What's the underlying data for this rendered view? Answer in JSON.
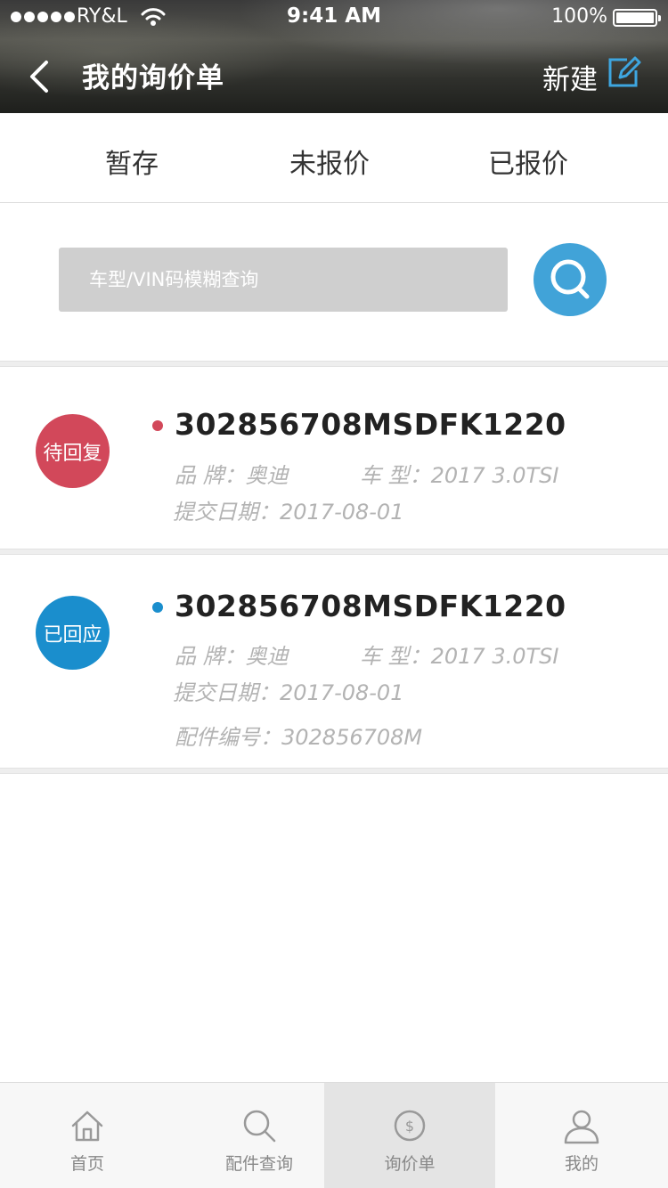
{
  "status_bar": {
    "carrier": "RY&L",
    "time": "9:41 AM",
    "battery": "100%"
  },
  "header": {
    "title": "我的询价单",
    "new_label": "新建"
  },
  "tabs": [
    {
      "label": "暂存"
    },
    {
      "label": "未报价"
    },
    {
      "label": "已报价"
    }
  ],
  "search": {
    "placeholder": "车型/VIN码模糊查询"
  },
  "cards": [
    {
      "status": "待回复",
      "status_color": "#d2485a",
      "dot_color": "#d2485a",
      "id": "302856708MSDFK1220",
      "brand": "品  牌：奥迪",
      "model": "车    型：2017 3.0TSI",
      "date": "提交日期：2017-08-01"
    },
    {
      "status": "已回应",
      "status_color": "#1a8ecd",
      "dot_color": "#1a8ecd",
      "id": "302856708MSDFK1220",
      "brand": "品  牌：奥迪",
      "model": "车    型：2017 3.0TSI",
      "date": "提交日期：2017-08-01",
      "part_no": "配件编号：302856708M"
    }
  ],
  "bottom_nav": [
    {
      "label": "首页",
      "icon": "home-icon"
    },
    {
      "label": "配件查询",
      "icon": "search-icon"
    },
    {
      "label": "询价单",
      "icon": "dollar-circle-icon",
      "active": true
    },
    {
      "label": "我的",
      "icon": "user-icon"
    }
  ],
  "colors": {
    "accent": "#41a3d8",
    "pending": "#d2485a",
    "responded": "#1a8ecd"
  }
}
